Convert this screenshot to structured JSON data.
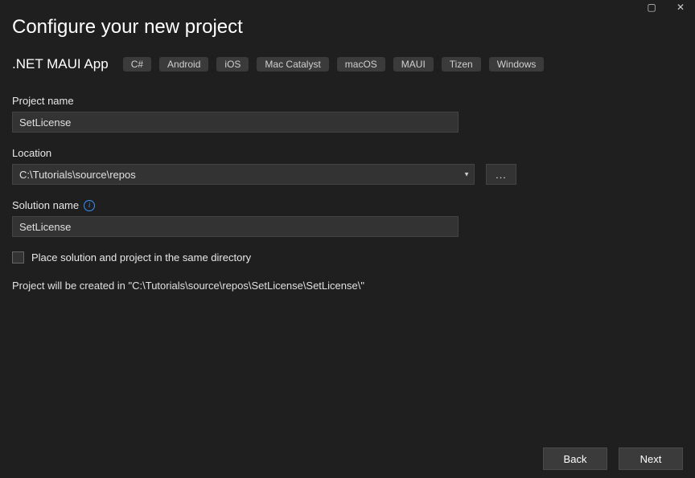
{
  "window": {
    "maximize_icon": "▢",
    "close_icon": "✕"
  },
  "header": {
    "title": "Configure your new project",
    "template_name": ".NET MAUI App",
    "tags": [
      "C#",
      "Android",
      "iOS",
      "Mac Catalyst",
      "macOS",
      "MAUI",
      "Tizen",
      "Windows"
    ]
  },
  "fields": {
    "project_name": {
      "label": "Project name",
      "value": "SetLicense"
    },
    "location": {
      "label": "Location",
      "value": "C:\\Tutorials\\source\\repos",
      "browse_label": "..."
    },
    "solution_name": {
      "label": "Solution name",
      "value": "SetLicense",
      "info_glyph": "i"
    },
    "same_directory": {
      "label": "Place solution and project in the same directory",
      "checked": false
    }
  },
  "path_preview": "Project will be created in \"C:\\Tutorials\\source\\repos\\SetLicense\\SetLicense\\\"",
  "footer": {
    "back_label": "Back",
    "next_label": "Next"
  }
}
